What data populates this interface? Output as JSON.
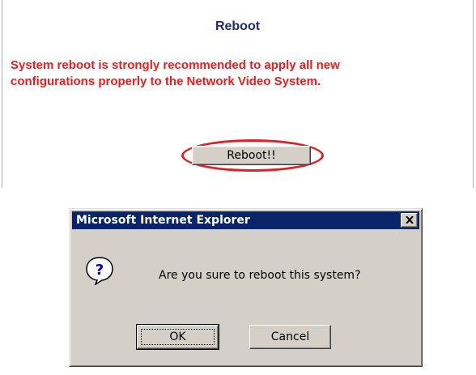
{
  "panel": {
    "title": "Reboot",
    "message_line1": "System reboot is strongly recommended to apply all new",
    "message_line2": "configurations properly to the Network Video System.",
    "reboot_button_label": "Reboot!!",
    "highlight_color": "#e31e24",
    "title_color": "#1f2a7a",
    "message_color": "#ee1c1c"
  },
  "dialog": {
    "title": "Microsoft Internet Explorer",
    "message": "Are you sure to reboot this system?",
    "icon": "question-icon",
    "close_icon": "close-icon",
    "ok_label": "OK",
    "cancel_label": "Cancel",
    "titlebar_color": "#0a246a"
  }
}
